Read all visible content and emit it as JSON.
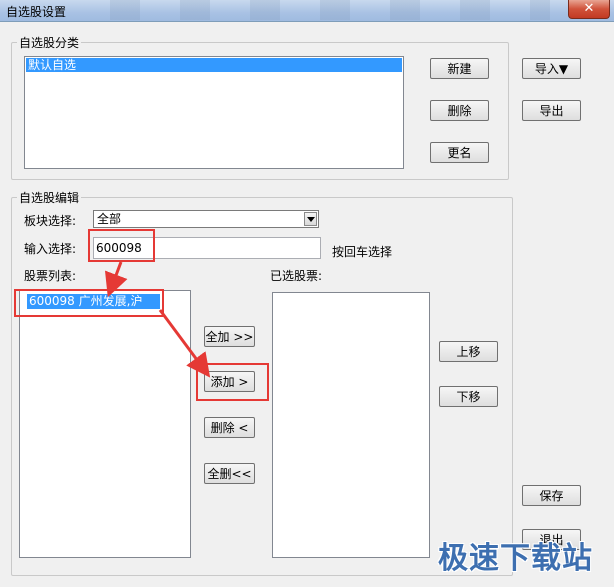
{
  "window": {
    "title": "自选股设置",
    "close_label": "✕"
  },
  "category_group": {
    "label": "自选股分类",
    "list_items": [
      "默认自选"
    ],
    "buttons": {
      "new": "新建",
      "delete": "删除",
      "rename": "更名"
    }
  },
  "side_buttons": {
    "import": "导入▼",
    "export": "导出",
    "save": "保存",
    "exit": "退出"
  },
  "edit_group": {
    "label": "自选股编辑",
    "sector_label": "板块选择:",
    "sector_value": "全部",
    "input_label": "输入选择:",
    "input_value": "600098",
    "enter_hint": "按回车选择",
    "stock_list_label": "股票列表:",
    "stock_list_items": [
      "600098   广州发展,沪"
    ],
    "selected_list_label": "已选股票:",
    "transfer_buttons": {
      "add_all": "全加 >>",
      "add": "添加 >",
      "remove": "删除 <",
      "remove_all": "全删<<"
    },
    "order_buttons": {
      "up": "上移",
      "down": "下移"
    }
  },
  "watermark": {
    "text": "极速下载站"
  },
  "colors": {
    "annotation": "#e53935",
    "selection": "#3399ff"
  }
}
